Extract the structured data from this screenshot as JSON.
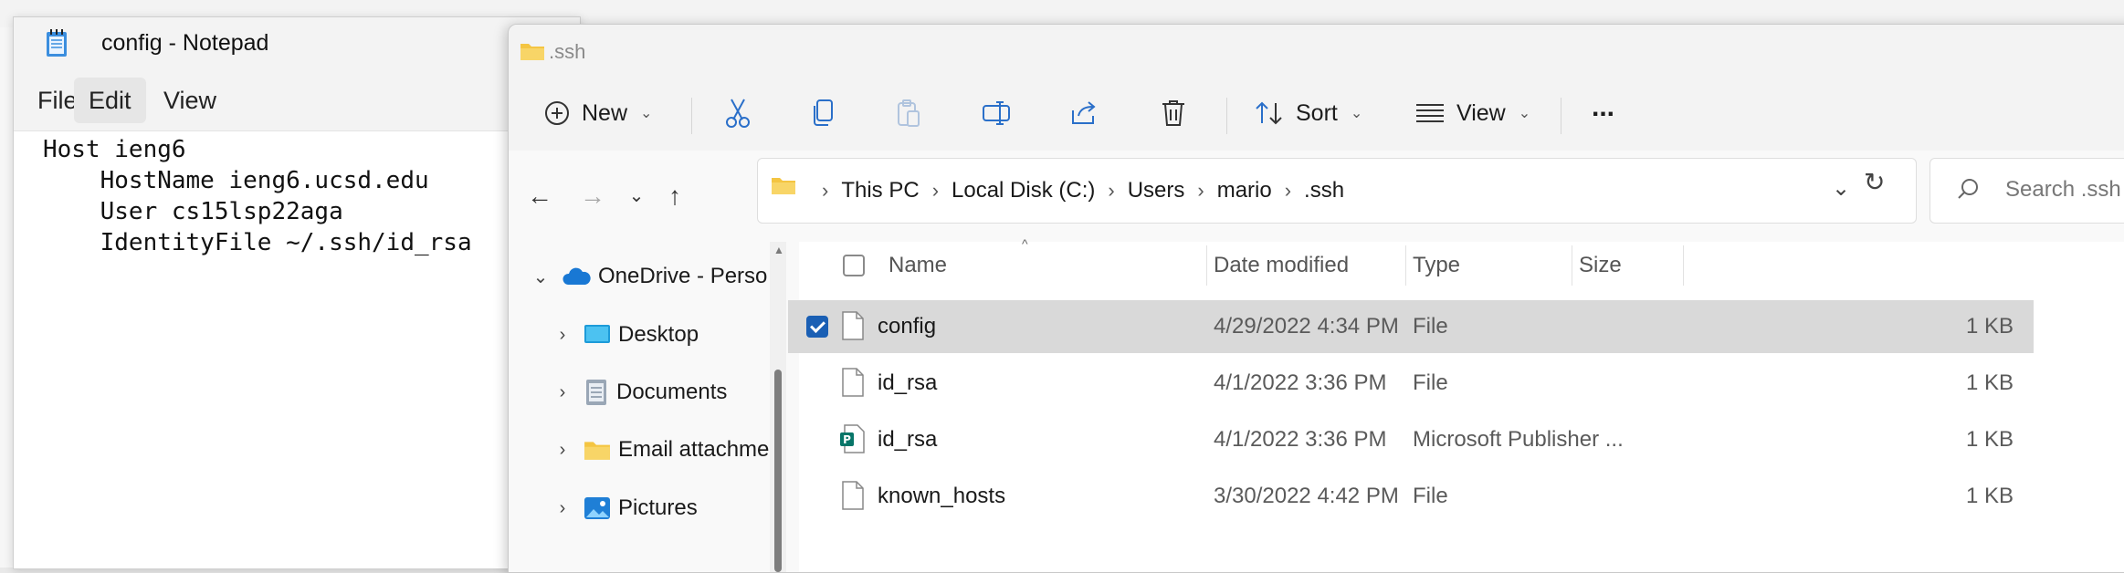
{
  "notepad": {
    "title": "config - Notepad",
    "menu": [
      "File",
      "Edit",
      "View"
    ],
    "content": "Host ieng6\n    HostName ieng6.ucsd.edu\n    User cs15lsp22aga\n    IdentityFile ~/.ssh/id_rsa"
  },
  "explorer": {
    "title": ".ssh",
    "toolbar": {
      "new_label": "New",
      "sort_label": "Sort",
      "view_label": "View",
      "more_label": "..."
    },
    "breadcrumbs": [
      "This PC",
      "Local Disk (C:)",
      "Users",
      "mario",
      ".ssh"
    ],
    "search_placeholder": "Search .ssh",
    "nav_tree": [
      {
        "label": "OneDrive - Perso",
        "icon": "onedrive-cloud-icon",
        "expanded": true
      },
      {
        "label": "Desktop",
        "icon": "desktop-icon"
      },
      {
        "label": "Documents",
        "icon": "documents-icon"
      },
      {
        "label": "Email attachme",
        "icon": "folder-icon"
      },
      {
        "label": "Pictures",
        "icon": "pictures-icon"
      }
    ],
    "columns": [
      "Name",
      "Date modified",
      "Type",
      "Size"
    ],
    "files": [
      {
        "name": "config",
        "date": "4/29/2022 4:34 PM",
        "type": "File",
        "size": "1 KB",
        "selected": true,
        "icon": "file-icon"
      },
      {
        "name": "id_rsa",
        "date": "4/1/2022 3:36 PM",
        "type": "File",
        "size": "1 KB",
        "selected": false,
        "icon": "file-icon"
      },
      {
        "name": "id_rsa",
        "date": "4/1/2022 3:36 PM",
        "type": "Microsoft Publisher ...",
        "size": "1 KB",
        "selected": false,
        "icon": "publisher-file-icon"
      },
      {
        "name": "known_hosts",
        "date": "3/30/2022 4:42 PM",
        "type": "File",
        "size": "1 KB",
        "selected": false,
        "icon": "file-icon"
      }
    ]
  },
  "colors": {
    "accent": "#1a5fb4",
    "folder": "#f4c542",
    "selection": "#d9d9d9"
  }
}
